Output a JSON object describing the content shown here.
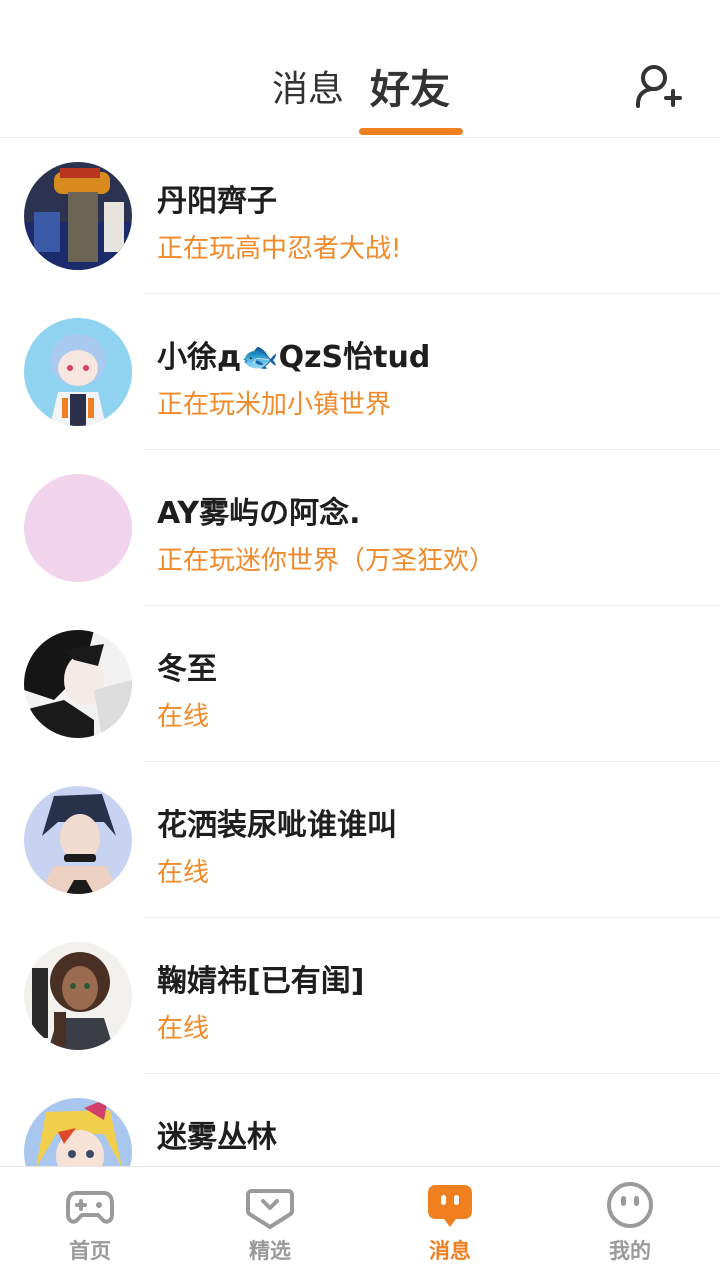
{
  "header": {
    "tabs": [
      {
        "label": "消息",
        "active": false
      },
      {
        "label": "好友",
        "active": true
      }
    ],
    "accent_color": "#f07f1f",
    "add_friend_icon": "add-person-icon"
  },
  "friends": [
    {
      "name": "丹阳齊子",
      "status": "正在玩高中忍者大战!"
    },
    {
      "name": "小徐д🐟QzS怡tud",
      "status": "正在玩米加小镇世界"
    },
    {
      "name": "AY雾屿の阿念.",
      "status": "正在玩迷你世界（万圣狂欢）"
    },
    {
      "name": "冬至",
      "status": "在线"
    },
    {
      "name": "花洒装尿呲谁谁叫",
      "status": "在线"
    },
    {
      "name": "鞠婧祎[已有闺]",
      "status": "在线"
    },
    {
      "name": "迷雾丛林",
      "status": ""
    }
  ],
  "status_color": "#f08a2a",
  "bottom_nav": [
    {
      "label": "首页",
      "icon": "gamepad-icon",
      "active": false
    },
    {
      "label": "精选",
      "icon": "heart-chat-icon",
      "active": false
    },
    {
      "label": "消息",
      "icon": "message-icon",
      "active": true
    },
    {
      "label": "我的",
      "icon": "smiley-face-icon",
      "active": false
    }
  ]
}
